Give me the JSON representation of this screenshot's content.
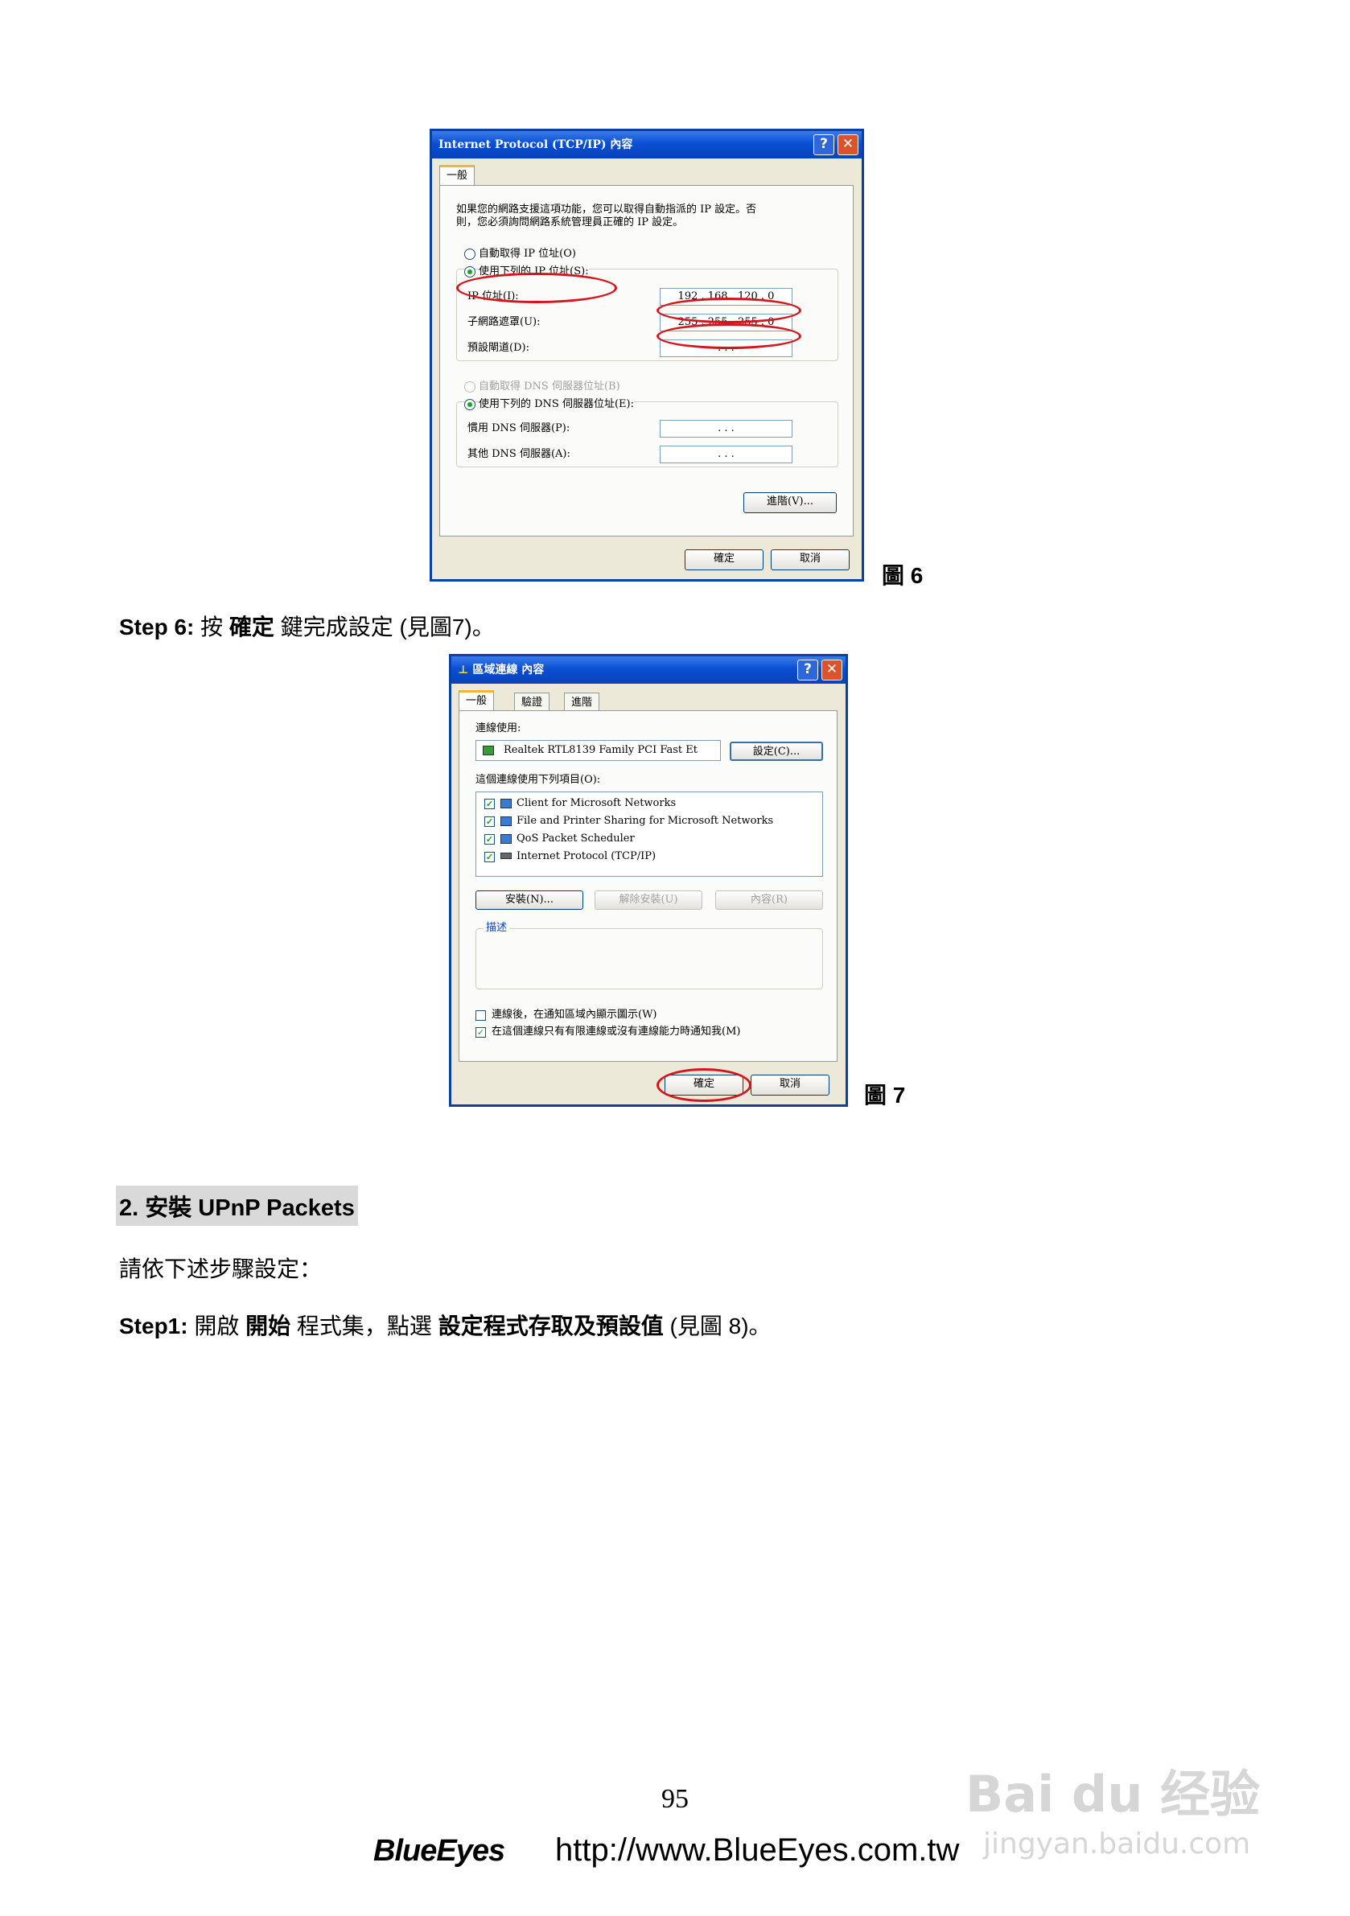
{
  "fig6": {
    "title": "Internet Protocol (TCP/IP) 內容",
    "tab": "一般",
    "desc_line1": "如果您的網路支援這項功能，您可以取得自動指派的 IP 設定。否",
    "desc_line2": "則，您必須詢問網路系統管理員正確的 IP 設定。",
    "radio_auto_ip": "自動取得 IP 位址(O)",
    "radio_use_ip": "使用下列的 IP 位址(S):",
    "ip_label": "IP 位址(I):",
    "ip_value": "192 . 168 . 120 .  0",
    "mask_label": "子網路遮罩(U):",
    "mask_value": "255 . 255 . 255 .  0",
    "gateway_label": "預設閘道(D):",
    "gateway_value": ".     .     .",
    "radio_auto_dns": "自動取得 DNS 伺服器位址(B)",
    "radio_use_dns": "使用下列的 DNS 伺服器位址(E):",
    "dns1_label": "慣用 DNS 伺服器(P):",
    "dns1_value": ".     .     .",
    "dns2_label": "其他 DNS 伺服器(A):",
    "dns2_value": ".     .     .",
    "advanced": "進階(V)...",
    "ok": "確定",
    "cancel": "取消",
    "caption": "圖 6"
  },
  "step6": {
    "prefix": "Step 6:",
    "t1": " 按 ",
    "bold": "確定",
    "t2": " 鍵完成設定 (見圖7)。"
  },
  "fig7": {
    "title": "區域連線 內容",
    "tabs": [
      "一般",
      "驗證",
      "進階"
    ],
    "connect_using": "連線使用:",
    "adapter": "Realtek RTL8139 Family PCI Fast Et",
    "configure": "設定(C)...",
    "items_label": "這個連線使用下列項目(O):",
    "items": [
      "Client for Microsoft Networks",
      "File and Printer Sharing for Microsoft Networks",
      "QoS Packet Scheduler",
      "Internet Protocol (TCP/IP)"
    ],
    "install": "安裝(N)...",
    "uninstall": "解除安裝(U)",
    "properties": "內容(R)",
    "description": "描述",
    "chk1": "連線後，在通知區域內顯示圖示(W)",
    "chk2": "在這個連線只有有限連線或沒有連線能力時通知我(M)",
    "ok": "確定",
    "cancel": "取消",
    "caption": "圖 7"
  },
  "section2": {
    "heading": "2. 安裝 UPnP Packets",
    "intro": "請依下述步驟設定：",
    "step1_prefix": "Step1:",
    "step1_t1": " 開啟 ",
    "step1_b1": "開始",
    "step1_t2": " 程式集，點選 ",
    "step1_b2": "設定程式存取及預設值",
    "step1_t3": " (見圖 8)。"
  },
  "footer": {
    "page_number": "95",
    "brand": "BlueEyes",
    "url": "http://www.BlueEyes.com.tw"
  },
  "watermark": {
    "brand": "Bai du 经验",
    "url": "jingyan.baidu.com"
  }
}
